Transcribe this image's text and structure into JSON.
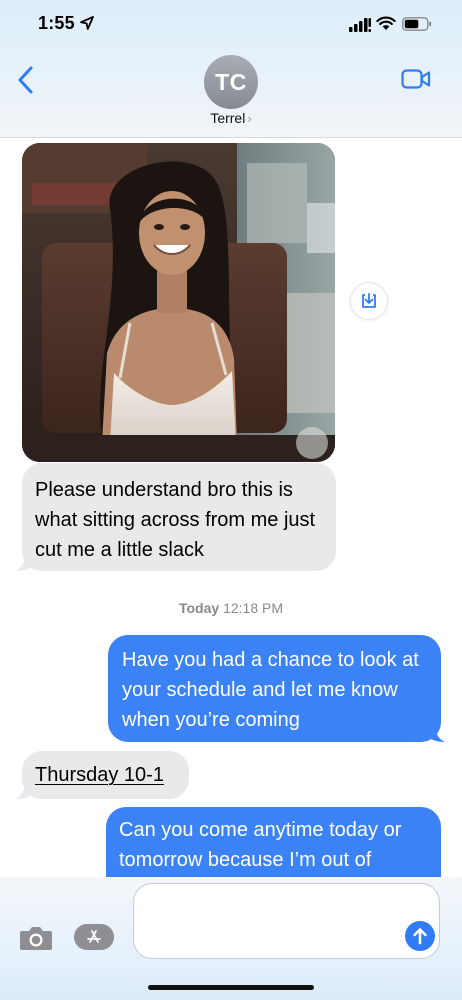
{
  "status_bar": {
    "time": "1:55",
    "icons": [
      "location-arrow-icon",
      "cellular-signal-icon",
      "wifi-icon",
      "battery-icon"
    ]
  },
  "header": {
    "back_icon": "chevron-left-icon",
    "contact_initials": "TC",
    "contact_name": "Terrel",
    "contact_chevron": "›",
    "video_icon": "video-camera-icon"
  },
  "conversation": {
    "incoming_photo": {
      "description_icon": "photo",
      "save_icon": "download-icon"
    },
    "messages": [
      {
        "direction": "incoming",
        "text": "Please understand bro this is what sitting across from me just cut me a little slack"
      },
      {
        "direction": "outgoing",
        "text": "Have you had a chance to look at your schedule and let me know when you’re coming"
      },
      {
        "direction": "incoming",
        "text": "Thursday 10-1"
      },
      {
        "direction": "outgoing",
        "text": "Can you come anytime today or tomorrow because I’m out of"
      }
    ],
    "timestamp": {
      "day": "Today",
      "time": "12:18 PM"
    }
  },
  "input_bar": {
    "camera_icon": "camera-icon",
    "apps_icon": "app-store-icon",
    "message_value": "",
    "message_placeholder": "",
    "send_icon": "arrow-up-icon"
  },
  "colors": {
    "outgoing_bubble": "#3a82f6",
    "incoming_bubble": "#e9e9eb",
    "accent": "#2f7cf6",
    "header_bg": "#e6f1fa"
  }
}
